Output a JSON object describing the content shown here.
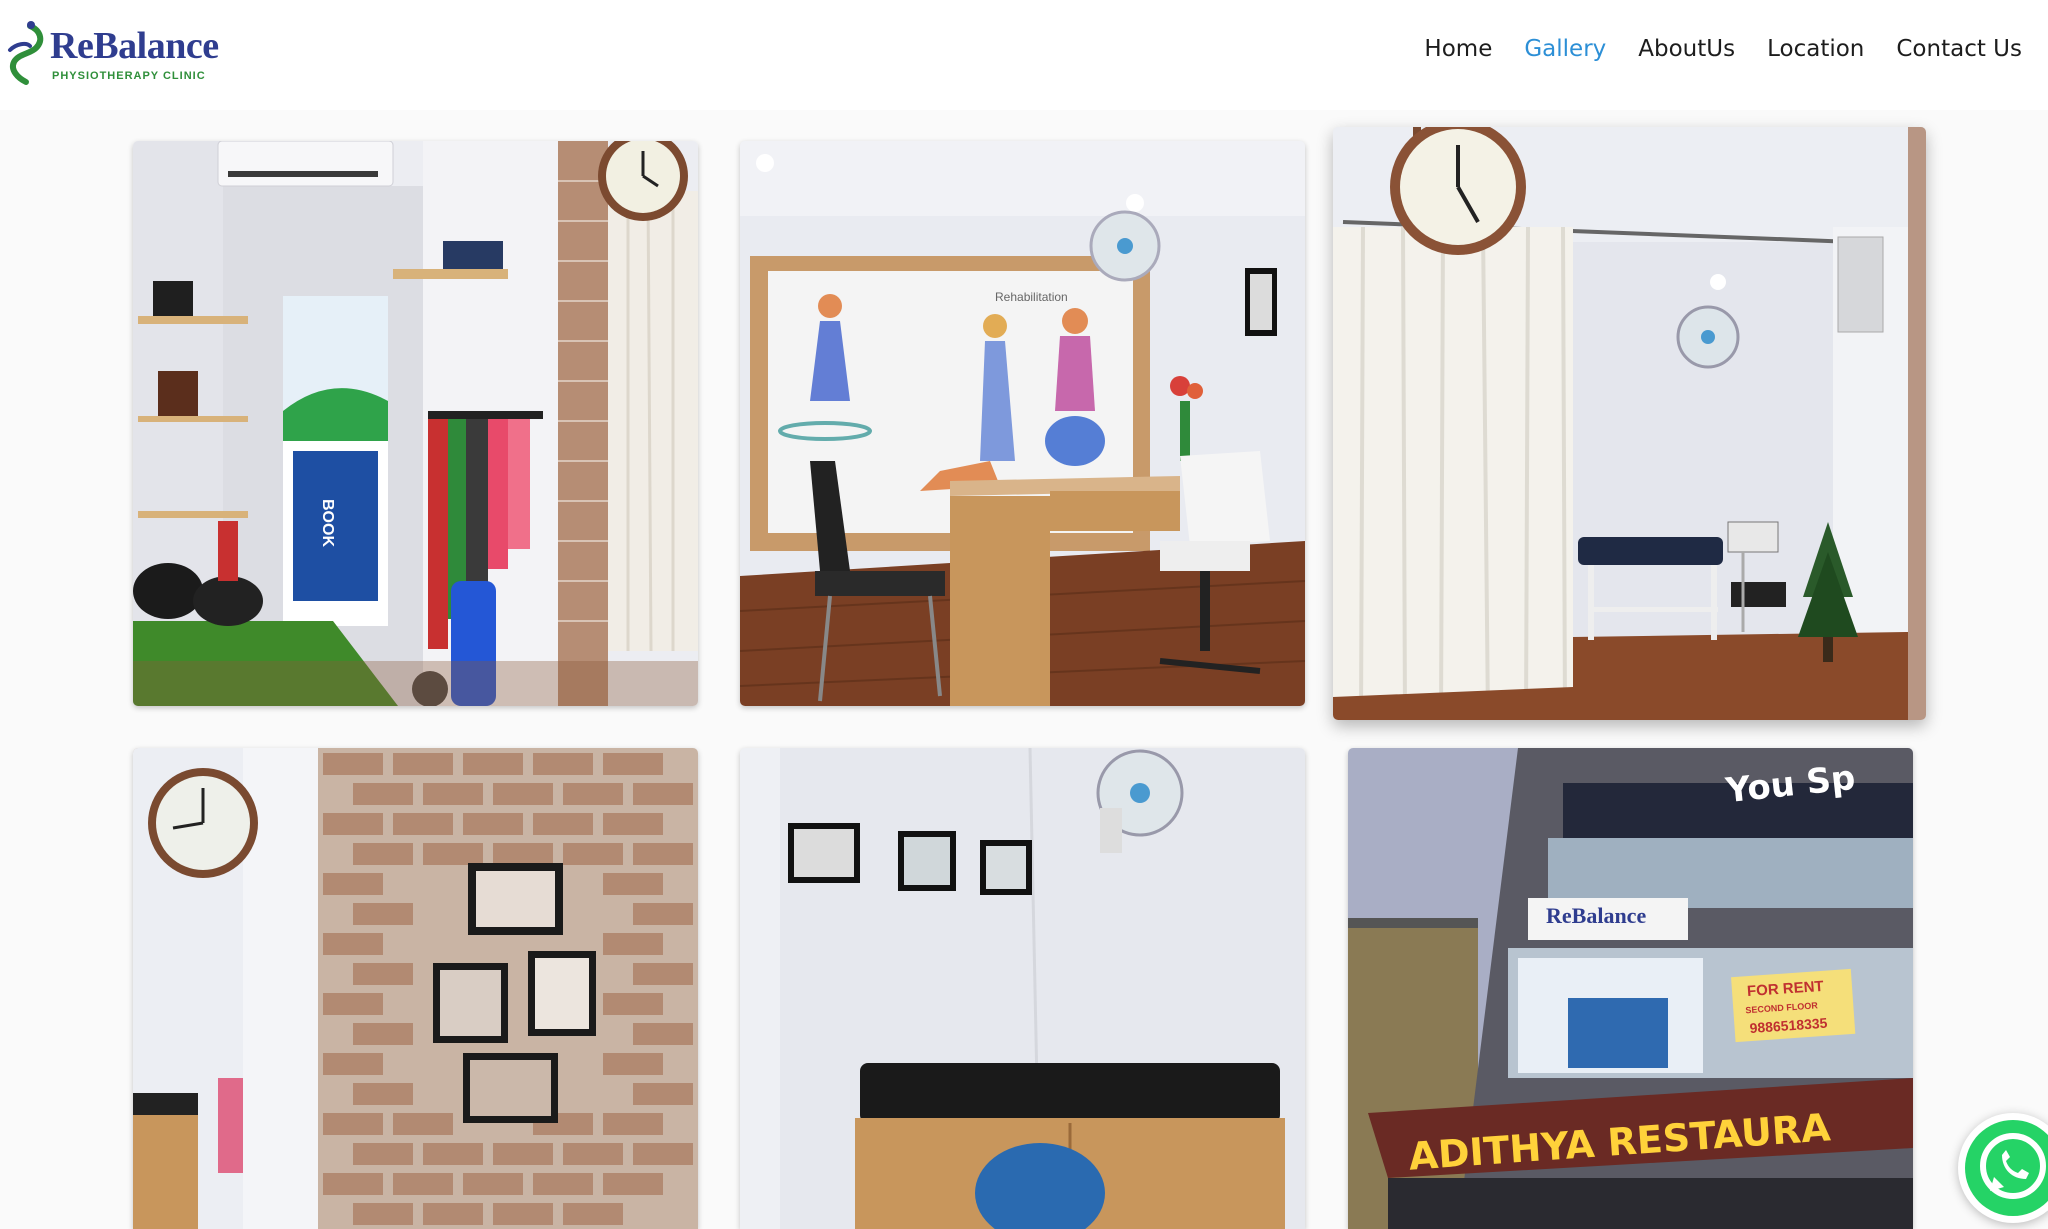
{
  "brand": {
    "name": "ReBalance",
    "tagline": "PHYSIOTHERAPY CLINIC",
    "colors": {
      "name": "#2f3d8f",
      "tagline": "#2f8f3a"
    }
  },
  "nav": {
    "items": [
      {
        "label": "Home",
        "active": false
      },
      {
        "label": "Gallery",
        "active": true
      },
      {
        "label": "AboutUs",
        "active": false
      },
      {
        "label": "Location",
        "active": false
      },
      {
        "label": "Contact Us",
        "active": false
      }
    ],
    "active_color": "#2c8fd6"
  },
  "gallery": {
    "photos": [
      {
        "subject": "exercise-corner-photo",
        "poster_text": "BOOK"
      },
      {
        "subject": "consultation-room-photo",
        "board_text": "Rehabilitation"
      },
      {
        "subject": "treatment-cubicle-photo"
      },
      {
        "subject": "brick-wall-photo"
      },
      {
        "subject": "waiting-bench-photo"
      },
      {
        "subject": "building-exterior-photo",
        "signs": {
          "restaurant": "ADITHYA RESTAURA",
          "shop": "You Sp",
          "clinic_board": "ReBalance",
          "rent_title": "FOR RENT",
          "rent_sub": "SECOND FLOOR",
          "rent_phone": "9886518335"
        }
      }
    ]
  },
  "floating": {
    "icon": "whatsapp-icon",
    "color": "#25d366"
  }
}
